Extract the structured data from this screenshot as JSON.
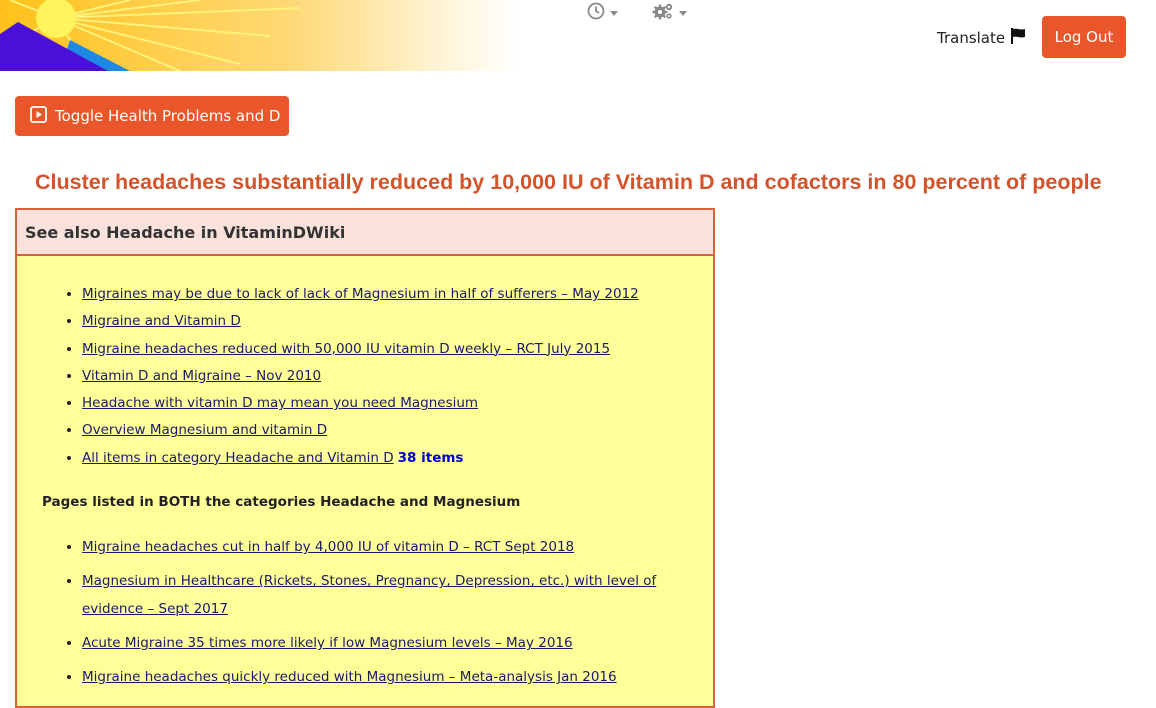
{
  "header": {
    "translate_label": "Translate",
    "logout_label": "Log Out",
    "history_icon": "clock-icon",
    "settings_icon": "gears-icon",
    "flag_icon": "flag-icon"
  },
  "toggle_button": {
    "label": "Toggle Health Problems and D",
    "icon": "play-square-icon"
  },
  "page_title": "Cluster headaches substantially reduced by 10,000 IU of Vitamin D and cofactors in 80 percent of people",
  "see_also": {
    "title": "See also Headache in VitaminDWiki",
    "links": [
      "Migraines may be due to lack of lack of Magnesium in half of sufferers – May 2012",
      "Migraine and Vitamin D",
      "Migraine headaches reduced with 50,000 IU vitamin D weekly – RCT July 2015",
      "Vitamin D and Migraine – Nov 2010",
      "Headache with vitamin D may mean you need Magnesium",
      "Overview Magnesium and vitamin D",
      "All items in category Headache and Vitamin D"
    ],
    "items_count": "38 items",
    "both_heading": "Pages listed in BOTH the categories Headache and Magnesium",
    "both_links": [
      "Migraine headaches cut in half by 4,000 IU of vitamin D – RCT Sept 2018",
      "Magnesium in Healthcare (Rickets, Stones, Pregnancy, Depression, etc.) with level of evidence – Sept 2017",
      "Acute Migraine 35 times more likely if low Magnesium levels – May 2016",
      "Migraine headaches quickly reduced with Magnesium – Meta-analysis Jan 2016"
    ]
  },
  "colors": {
    "accent": "#e8562a",
    "title": "#d4532a",
    "box_border": "#d9603b",
    "box_bg": "#ffff99",
    "box_header_bg": "#f9e2dc",
    "link": "#1a1a66",
    "count": "#0000cc"
  }
}
